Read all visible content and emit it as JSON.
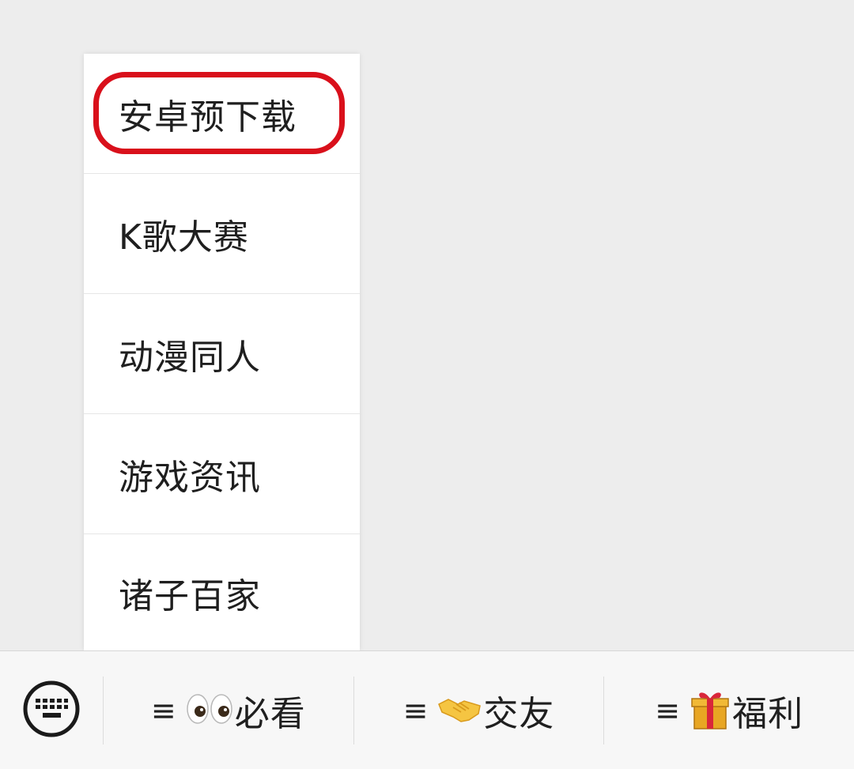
{
  "submenu": {
    "items": [
      {
        "label": "安卓预下载",
        "highlighted": true
      },
      {
        "label": "K歌大赛",
        "highlighted": false
      },
      {
        "label": "动漫同人",
        "highlighted": false
      },
      {
        "label": "游戏资讯",
        "highlighted": false
      },
      {
        "label": "诸子百家",
        "highlighted": false
      }
    ],
    "highlight_color": "#d9101b"
  },
  "menubar": {
    "keyboard_icon": "keyboard-icon",
    "tabs": [
      {
        "icon": "menu-icon",
        "emoji": "eyes-emoji",
        "label": "必看"
      },
      {
        "icon": "menu-icon",
        "emoji": "handshake-emoji",
        "label": "交友"
      },
      {
        "icon": "menu-icon",
        "emoji": "gift-emoji",
        "label": "福利"
      }
    ],
    "hamburger_glyph": "≡"
  }
}
